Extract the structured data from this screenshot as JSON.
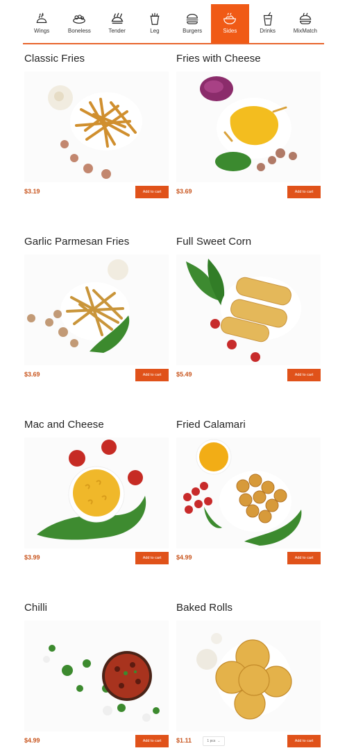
{
  "nav": {
    "items": [
      {
        "label": "Wings",
        "icon": "wings-icon",
        "active": false
      },
      {
        "label": "Boneless",
        "icon": "boneless-icon",
        "active": false
      },
      {
        "label": "Tender",
        "icon": "tender-icon",
        "active": false
      },
      {
        "label": "Leg",
        "icon": "leg-icon",
        "active": false
      },
      {
        "label": "Burgers",
        "icon": "burger-icon",
        "active": false
      },
      {
        "label": "Sides",
        "icon": "sides-icon",
        "active": true
      },
      {
        "label": "Drinks",
        "icon": "drink-icon",
        "active": false
      },
      {
        "label": "MixMatch",
        "icon": "mixmatch-icon",
        "active": false
      }
    ],
    "accent": "#f05a16"
  },
  "products": [
    {
      "name": "Classic Fries",
      "price": "$3.19",
      "button": "Add to cart"
    },
    {
      "name": "Fries with Cheese",
      "price": "$3.69",
      "button": "Add to cart"
    },
    {
      "name": "Garlic Parmesan Fries",
      "price": "$3.69",
      "button": "Add to cart"
    },
    {
      "name": "Full Sweet Corn",
      "price": "$5.49",
      "button": "Add to cart"
    },
    {
      "name": "Mac and Cheese",
      "price": "$3.99",
      "button": "Add to cart"
    },
    {
      "name": "Fried Calamari",
      "price": "$4.99",
      "button": "Add to cart"
    },
    {
      "name": "Chilli",
      "price": "$4.99",
      "button": "Add to cart"
    },
    {
      "name": "Baked Rolls",
      "price": "$1.11",
      "button": "Add to cart",
      "quantity": "1 pcs"
    }
  ]
}
